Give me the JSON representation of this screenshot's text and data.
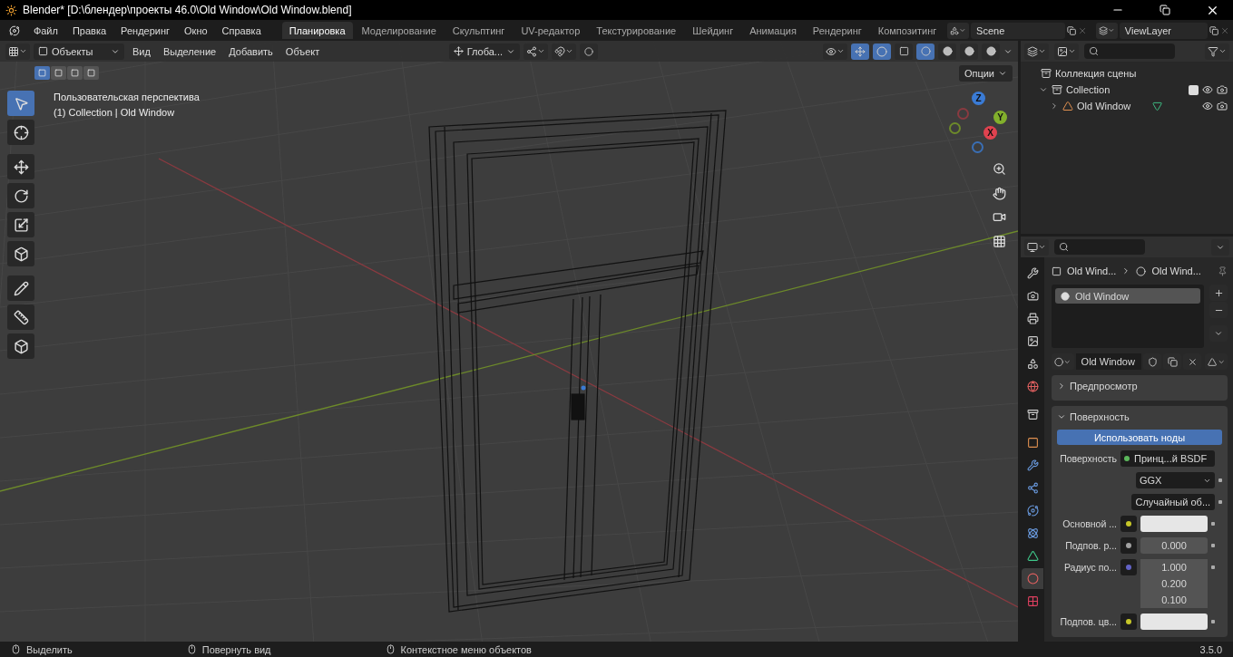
{
  "window": {
    "title": "Blender* [D:\\блендер\\проекты 46.0\\Old Window\\Old Window.blend]"
  },
  "menu": [
    "Файл",
    "Правка",
    "Рендеринг",
    "Окно",
    "Справка"
  ],
  "workspaces": [
    {
      "label": "Планировка",
      "selected": true
    },
    {
      "label": "Моделирование",
      "selected": false
    },
    {
      "label": "Скульптинг",
      "selected": false
    },
    {
      "label": "UV-редактор",
      "selected": false
    },
    {
      "label": "Текстурирование",
      "selected": false
    },
    {
      "label": "Шейдинг",
      "selected": false
    },
    {
      "label": "Анимация",
      "selected": false
    },
    {
      "label": "Рендеринг",
      "selected": false
    },
    {
      "label": "Композитинг",
      "selected": false
    }
  ],
  "scene": {
    "value": "Scene"
  },
  "view_layer": {
    "value": "ViewLayer"
  },
  "viewport": {
    "mode": "Объекты",
    "menus": [
      "Вид",
      "Выделение",
      "Добавить",
      "Объект"
    ],
    "orientation": "Глоба...",
    "options": "Опции",
    "select_modes": [
      {
        "selected": true
      },
      {
        "selected": false
      },
      {
        "selected": false
      },
      {
        "selected": false
      }
    ],
    "shading": [
      {
        "selected": true
      },
      {
        "selected": false
      },
      {
        "selected": false
      },
      {
        "selected": false
      }
    ],
    "view_name": "Пользовательская перспектива",
    "info": "(1) Collection | Old Window",
    "tools": [
      {
        "selected": true
      },
      {
        "selected": false
      },
      {
        "selected": false
      },
      {
        "selected": false
      },
      {
        "selected": false
      },
      {
        "selected": false
      },
      {
        "selected": false
      },
      {
        "selected": false
      },
      {
        "selected": false
      }
    ],
    "axes": [
      "Z",
      "Y",
      "X"
    ]
  },
  "outliner": {
    "items": [
      {
        "label": "Коллекция сцены",
        "children": [
          {
            "label": "Collection",
            "expanded": true,
            "checked": true,
            "children": [
              {
                "label": "Old Window",
                "expanded": false
              }
            ]
          }
        ]
      }
    ]
  },
  "properties": {
    "tabs": [
      {
        "selected": false
      },
      {
        "selected": false
      },
      {
        "selected": false
      },
      {
        "selected": false
      },
      {
        "selected": false
      },
      {
        "selected": false
      },
      {
        "selected": false
      },
      {
        "selected": false
      },
      {
        "selected": false
      },
      {
        "selected": false
      },
      {
        "selected": false
      },
      {
        "selected": false
      },
      {
        "selected": false
      },
      {
        "selected": true
      },
      {
        "selected": false
      }
    ],
    "breadcrumb": [
      "Old Wind...",
      "Old Wind..."
    ],
    "slots": [
      {
        "label": "Old Window",
        "selected": true
      }
    ],
    "material": "Old Window",
    "panels": [
      {
        "label": "Предпросмотр",
        "expanded": false
      },
      {
        "label": "Поверхность",
        "expanded": true
      }
    ],
    "use_nodes": "Использовать ноды",
    "rows": [
      {
        "kind": "link",
        "label": "Поверхность",
        "value": "Принц...й BSDF",
        "color": "#5cb85c"
      },
      {
        "kind": "dropdown",
        "value": "GGX"
      },
      {
        "kind": "dropdown",
        "value": "Случайный об..."
      },
      {
        "kind": "swatch",
        "label": "Основной ...",
        "color": "#c7c729"
      },
      {
        "kind": "number",
        "label": "Подпов. р...",
        "value": "0.000",
        "color": "#a1a1a1"
      },
      {
        "kind": "vector",
        "label": "Радиус по...",
        "values": [
          "1.000",
          "0.200",
          "0.100"
        ],
        "color": "#6363c7"
      },
      {
        "kind": "swatch",
        "label": "Подпов. цв...",
        "color": "#c7c729"
      }
    ]
  },
  "status": {
    "hints": [
      "Выделить",
      "Повернуть вид",
      "Контекстное меню объектов"
    ],
    "version": "3.5.0"
  }
}
